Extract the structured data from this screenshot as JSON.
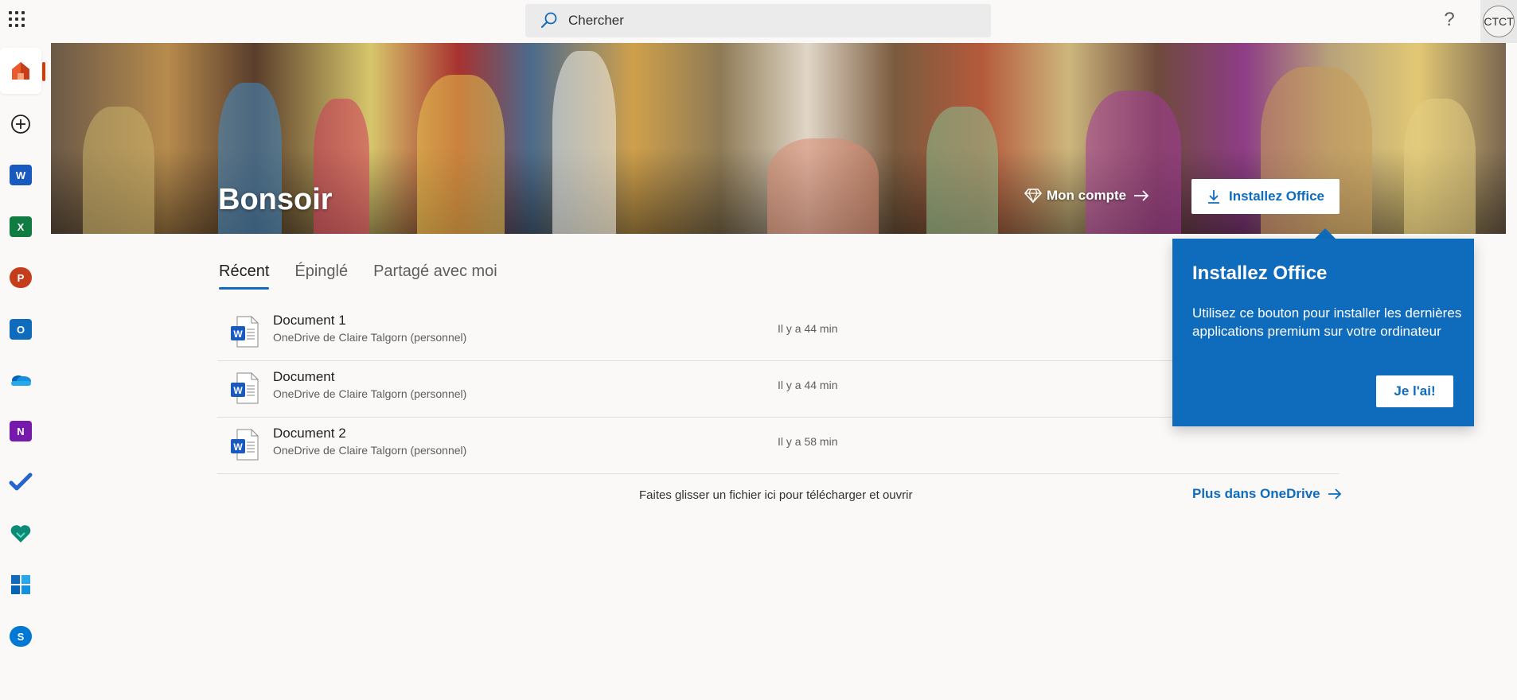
{
  "topbar": {
    "search_placeholder": "Chercher",
    "help_label": "?",
    "avatar_initials": "CTCT"
  },
  "rail": {
    "items": [
      {
        "name": "home",
        "icon": "home-icon"
      },
      {
        "name": "create",
        "icon": "add-circle-icon"
      },
      {
        "name": "word",
        "icon": "word-icon",
        "letter": "W",
        "color": "#185abd"
      },
      {
        "name": "excel",
        "icon": "excel-icon",
        "letter": "X",
        "color": "#107c41"
      },
      {
        "name": "powerpoint",
        "icon": "powerpoint-icon",
        "letter": "P",
        "color": "#c43e1c"
      },
      {
        "name": "outlook",
        "icon": "outlook-icon",
        "letter": "O",
        "color": "#0f6cbd"
      },
      {
        "name": "onedrive",
        "icon": "onedrive-icon"
      },
      {
        "name": "onenote",
        "icon": "onenote-icon",
        "letter": "N",
        "color": "#7719aa"
      },
      {
        "name": "todo",
        "icon": "todo-check-icon"
      },
      {
        "name": "family-safety",
        "icon": "heart-icon"
      },
      {
        "name": "calendar",
        "icon": "calendar-icon"
      },
      {
        "name": "skype",
        "icon": "skype-icon",
        "letter": "S",
        "color": "#0078d4"
      }
    ]
  },
  "hero": {
    "greeting": "Bonsoir",
    "account_label": "Mon compte",
    "install_label": "Installez Office"
  },
  "tabs": [
    {
      "label": "Récent",
      "active": true
    },
    {
      "label": "Épinglé",
      "active": false
    },
    {
      "label": "Partagé avec moi",
      "active": false
    }
  ],
  "files": [
    {
      "name": "Document 1",
      "location": "OneDrive de Claire Talgorn (personnel)",
      "time": "Il y a 44 min"
    },
    {
      "name": "Document",
      "location": "OneDrive de Claire Talgorn (personnel)",
      "time": "Il y a 44 min"
    },
    {
      "name": "Document 2",
      "location": "OneDrive de Claire Talgorn (personnel)",
      "time": "Il y a 58 min"
    }
  ],
  "drop_hint": "Faites glisser un fichier ici pour télécharger et ouvrir",
  "more_onedrive": "Plus dans OneDrive",
  "callout": {
    "title": "Installez Office",
    "body": "Utilisez ce bouton pour installer les dernières applications premium sur votre ordinateur",
    "button": "Je l'ai!"
  },
  "colors": {
    "accent": "#0f6cbd",
    "home_indicator": "#d83b01"
  }
}
